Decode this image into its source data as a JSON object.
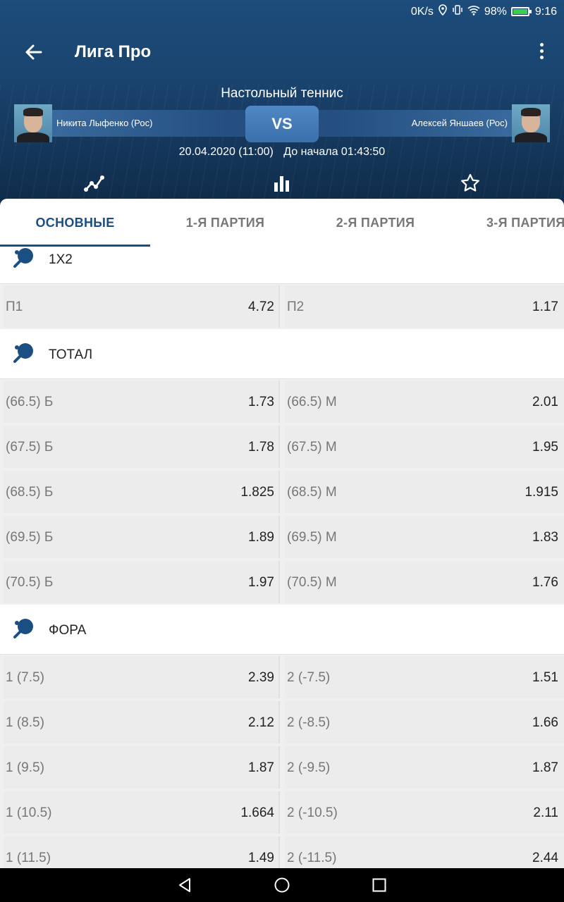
{
  "status_bar": {
    "speed": "0K/s",
    "battery": "98%",
    "time": "9:16"
  },
  "app_bar": {
    "title": "Лига Про"
  },
  "match": {
    "sport": "Настольный теннис",
    "player1": "Никита Лыфенко (Рос)",
    "player2": "Алексей Яншаев (Рос)",
    "vs": "VS",
    "datetime": "20.04.2020 (11:00)",
    "countdown": "До начала 01:43:50"
  },
  "icons": {
    "trend": "trend-line-icon",
    "stats": "bar-chart-icon",
    "favorite": "star-icon"
  },
  "tabs": [
    {
      "label": "ОСНОВНЫЕ",
      "active": true
    },
    {
      "label": "1-Я ПАРТИЯ",
      "active": false
    },
    {
      "label": "2-Я ПАРТИЯ",
      "active": false
    },
    {
      "label": "3-Я ПАРТИЯ",
      "active": false
    }
  ],
  "sections": [
    {
      "title": "1X2",
      "rows": [
        {
          "left_label": "П1",
          "left_odd": "4.72",
          "right_label": "П2",
          "right_odd": "1.17"
        }
      ]
    },
    {
      "title": "ТОТАЛ",
      "rows": [
        {
          "left_label": "(66.5) Б",
          "left_odd": "1.73",
          "right_label": "(66.5) М",
          "right_odd": "2.01"
        },
        {
          "left_label": "(67.5) Б",
          "left_odd": "1.78",
          "right_label": "(67.5) М",
          "right_odd": "1.95"
        },
        {
          "left_label": "(68.5) Б",
          "left_odd": "1.825",
          "right_label": "(68.5) М",
          "right_odd": "1.915"
        },
        {
          "left_label": "(69.5) Б",
          "left_odd": "1.89",
          "right_label": "(69.5) М",
          "right_odd": "1.83"
        },
        {
          "left_label": "(70.5) Б",
          "left_odd": "1.97",
          "right_label": "(70.5) М",
          "right_odd": "1.76"
        }
      ]
    },
    {
      "title": "ФОРА",
      "rows": [
        {
          "left_label": "1 (7.5)",
          "left_odd": "2.39",
          "right_label": "2 (-7.5)",
          "right_odd": "1.51"
        },
        {
          "left_label": "1 (8.5)",
          "left_odd": "2.12",
          "right_label": "2 (-8.5)",
          "right_odd": "1.66"
        },
        {
          "left_label": "1 (9.5)",
          "left_odd": "1.87",
          "right_label": "2 (-9.5)",
          "right_odd": "1.87"
        },
        {
          "left_label": "1 (10.5)",
          "left_odd": "1.664",
          "right_label": "2 (-10.5)",
          "right_odd": "2.11"
        },
        {
          "left_label": "1 (11.5)",
          "left_odd": "1.49",
          "right_label": "2 (-11.5)",
          "right_odd": "2.44"
        }
      ]
    }
  ],
  "colors": {
    "accent": "#1b4f83",
    "header": "#1a446f",
    "battery": "#3ecf4a"
  }
}
